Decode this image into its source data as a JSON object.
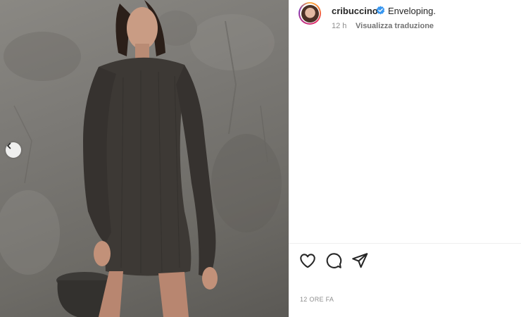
{
  "post": {
    "username": "cribuccino",
    "caption": "Enveloping.",
    "relative_time": "12 h",
    "translate_label": "Visualizza traduzione",
    "timestamp": "12 ORE FA"
  },
  "icons": {
    "avatar": "profile-avatar",
    "verified": "verified-badge-icon",
    "like": "heart-icon",
    "comment": "comment-icon",
    "share": "share-icon",
    "prev": "chevron-left-icon"
  },
  "colors": {
    "verified": "#3897f0",
    "text": "#262626",
    "muted": "#8e8e8e"
  }
}
